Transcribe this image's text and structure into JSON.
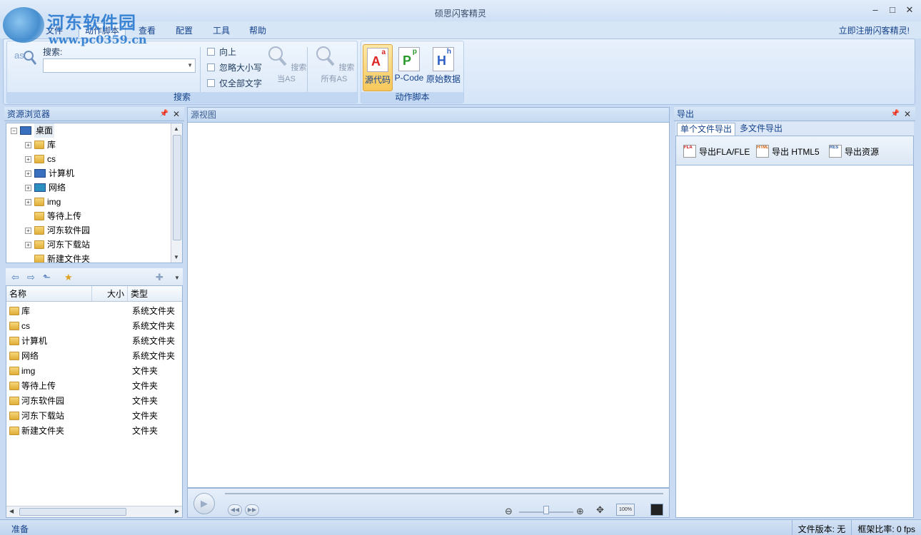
{
  "window": {
    "title": "硕思闪客精灵"
  },
  "watermark": {
    "line1": "河东软件园",
    "line2": "www.pc0359.cn"
  },
  "menu": {
    "tabs": [
      "文件",
      "动作脚本",
      "查看",
      "配置",
      "工具",
      "帮助"
    ],
    "register": "立即注册闪客精灵!"
  },
  "ribbon": {
    "search_group_label": "搜索",
    "search_label": "搜索:",
    "checkbox_up": "向上",
    "checkbox_ignore_case": "忽略大小写",
    "checkbox_whole_word": "仅全部文字",
    "search_current_as": "搜索当AS",
    "search_all_as": "搜索所有AS",
    "action_group_label": "动作脚本",
    "source_code": "源代码",
    "pcode": "P-Code",
    "raw_data": "原始数据"
  },
  "resource_browser": {
    "title": "资源浏览器",
    "tree": [
      {
        "label": "桌面",
        "icon": "desktop-icon"
      },
      {
        "label": "库",
        "icon": "library-icon"
      },
      {
        "label": "cs",
        "icon": "user-folder-icon"
      },
      {
        "label": "计算机",
        "icon": "computer-icon"
      },
      {
        "label": "网络",
        "icon": "network-icon"
      },
      {
        "label": "img",
        "icon": "folder-icon"
      },
      {
        "label": "等待上传",
        "icon": "folder-icon"
      },
      {
        "label": "河东软件园",
        "icon": "folder-icon"
      },
      {
        "label": "河东下载站",
        "icon": "folder-icon"
      },
      {
        "label": "新建文件夹",
        "icon": "folder-icon"
      }
    ],
    "list_headers": {
      "name": "名称",
      "size": "大小",
      "type": "类型"
    },
    "list_rows": [
      {
        "name": "库",
        "type": "系统文件夹"
      },
      {
        "name": "cs",
        "type": "系统文件夹"
      },
      {
        "name": "计算机",
        "type": "系统文件夹"
      },
      {
        "name": "网络",
        "type": "系统文件夹"
      },
      {
        "name": "img",
        "type": "文件夹"
      },
      {
        "name": "等待上传",
        "type": "文件夹"
      },
      {
        "name": "河东软件园",
        "type": "文件夹"
      },
      {
        "name": "河东下载站",
        "type": "文件夹"
      },
      {
        "name": "新建文件夹",
        "type": "文件夹"
      }
    ]
  },
  "source_view": {
    "title": "源视图"
  },
  "player": {
    "zoom_label": "100%"
  },
  "export_panel": {
    "title": "导出",
    "tabs": [
      "单个文件导出",
      "多文件导出"
    ],
    "buttons": {
      "fla": "导出FLA/FLE",
      "html5": "导出 HTML5",
      "resources": "导出资源"
    }
  },
  "status": {
    "left": "准备",
    "file_version": "文件版本: 无",
    "frame_rate": "框架比率: 0 fps"
  }
}
